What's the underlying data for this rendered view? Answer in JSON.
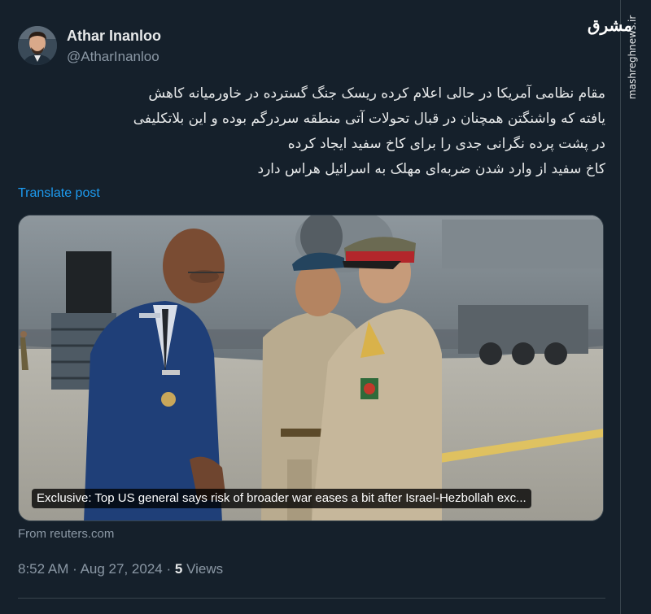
{
  "watermark": {
    "logo_text": "مشرق",
    "site_url": "mashreghnews.ir"
  },
  "author": {
    "name": "Athar Inanloo",
    "handle": "@AtharInanloo"
  },
  "tweet": {
    "lines": [
      "مقام نظامی آمریکا در حالی اعلام کرده ریسک جنگ گسترده در خاورمیانه کاهش",
      "یافته که واشنگتن همچنان در قبال تحولات آتی منطقه سردرگم بوده و این بلاتکلیفی",
      "در پشت پرده نگرانی جدی را برای کاخ سفید ایجاد کرده",
      "کاخ سفید از وارد شدن ضربه‌ای مهلک به اسرائیل هراس دارد"
    ],
    "translate_label": "Translate post"
  },
  "card": {
    "caption": "Exclusive: Top US general says risk of broader war eases a bit after Israel-Hezbollah exc...",
    "source": "From reuters.com"
  },
  "meta": {
    "time": "8:52 AM",
    "date": "Aug 27, 2024",
    "separator": "·",
    "views_count": "5",
    "views_label": "Views"
  },
  "colors": {
    "background": "#15202b",
    "text": "#e7e9ea",
    "secondary": "#8b98a5",
    "link": "#1d9bf0",
    "border": "#38444d"
  }
}
